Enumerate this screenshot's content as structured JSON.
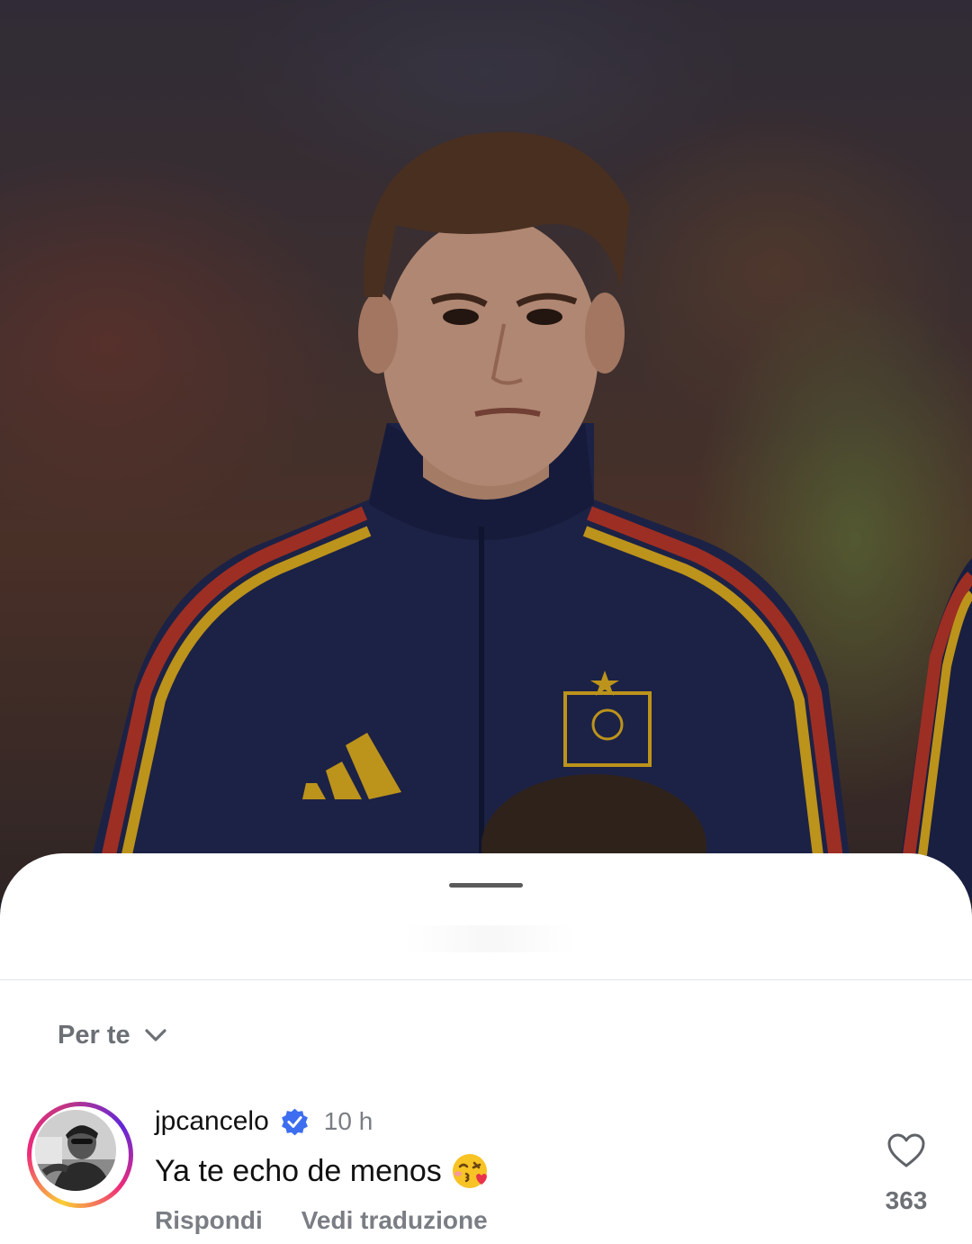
{
  "sheet": {
    "sort_label": "Per te",
    "sort_icon": "chevron-down-icon"
  },
  "comment": {
    "username": "jpcancelo",
    "verified_icon": "verified-badge-icon",
    "time": "10 h",
    "text": "Ya te echo de menos",
    "emoji": "kissing-face-icon",
    "actions": {
      "reply": "Rispondi",
      "translate": "Vedi traduzione"
    },
    "like_count": "363",
    "like_icon": "heart-icon"
  },
  "colors": {
    "verified": "#3897f0",
    "muted_text": "#7a7e84",
    "sheet_bg": "#ffffff",
    "jacket_navy": "#232a55",
    "stripe_red": "#c0392b",
    "stripe_yellow": "#e6b422"
  }
}
